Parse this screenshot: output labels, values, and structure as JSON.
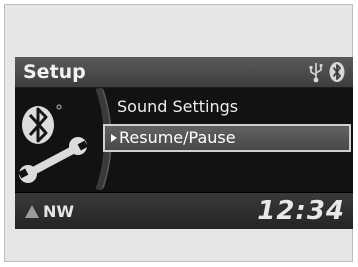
{
  "header": {
    "title": "Setup",
    "status_icons": [
      "usb-icon",
      "bluetooth-icon"
    ]
  },
  "menu": {
    "items": [
      {
        "label": "Sound Settings",
        "selected": false
      },
      {
        "label": "Resume/Pause",
        "selected": true
      }
    ],
    "panel_icons": [
      "bluetooth-icon",
      "wrench-icon"
    ]
  },
  "footer": {
    "compass_heading": "NW",
    "clock": "12:34"
  },
  "colors": {
    "screen_bg": "#101010",
    "highlight": "#555555",
    "text": "#eeeeee"
  }
}
